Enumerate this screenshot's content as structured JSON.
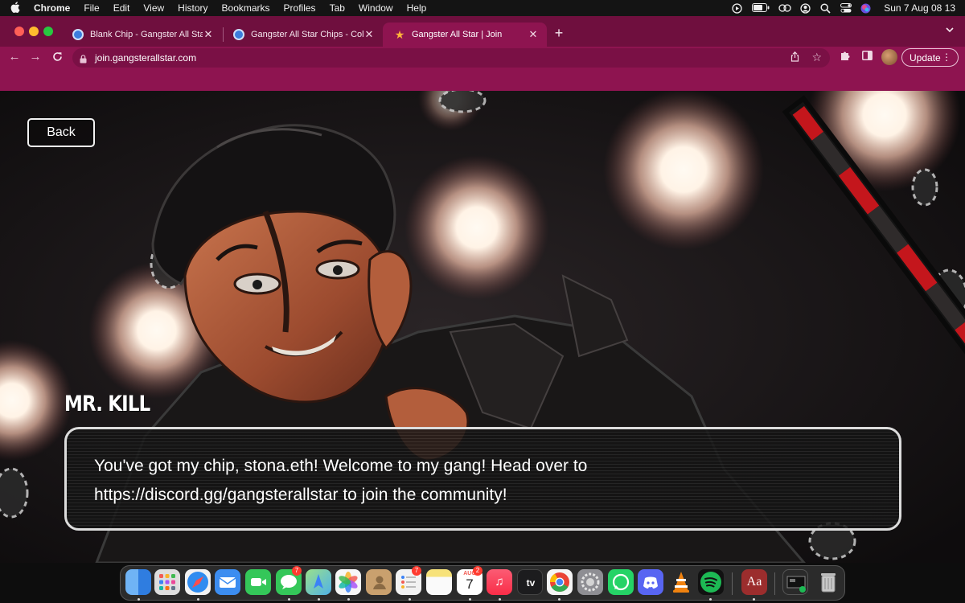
{
  "menubar": {
    "app": "Chrome",
    "items": [
      "File",
      "Edit",
      "View",
      "History",
      "Bookmarks",
      "Profiles",
      "Tab",
      "Window",
      "Help"
    ],
    "clock": "Sun 7 Aug  08 13"
  },
  "browser": {
    "tabs": [
      {
        "title": "Blank Chip - Gangster All Star",
        "favicon": "opensea-icon"
      },
      {
        "title": "Gangster All Star Chips - Colle",
        "favicon": "opensea-icon"
      },
      {
        "title": "Gangster All Star | Join",
        "favicon": "star-icon",
        "active": true
      }
    ],
    "url": "join.gangsterallstar.com",
    "update_label": "Update"
  },
  "page": {
    "back_label": "Back",
    "speaker": "MR. KILL",
    "dialogue_line1": "You've got my chip, stona.eth! Welcome to my gang! Head over to",
    "dialogue_line2": "https://discord.gg/gangsterallstar to join the community!"
  },
  "dock": {
    "apps": [
      {
        "name": "finder",
        "color": "#3d8ee8"
      },
      {
        "name": "launchpad",
        "color": "#e5e5e5"
      },
      {
        "name": "safari",
        "color": "#2f8cf0"
      },
      {
        "name": "mail",
        "color": "#3c8df0"
      },
      {
        "name": "facetime",
        "color": "#34c759"
      },
      {
        "name": "messages",
        "color": "#34c759",
        "badge": "7"
      },
      {
        "name": "maps",
        "color": "#6cc06a"
      },
      {
        "name": "photos",
        "color": "#f0f0f0"
      },
      {
        "name": "contacts",
        "color": "#c9a06e"
      },
      {
        "name": "reminders",
        "color": "#f2f2f2",
        "badge": "7"
      },
      {
        "name": "notes",
        "color": "#f7e27a"
      },
      {
        "name": "calendar",
        "color": "#ffffff",
        "badge": "2",
        "label": "7",
        "month": "AUG"
      },
      {
        "name": "music",
        "color": "#fa3d55"
      },
      {
        "name": "tv",
        "color": "#1c1c1e",
        "label": "tv"
      },
      {
        "name": "chrome",
        "color": "#ffffff"
      },
      {
        "name": "system-settings",
        "color": "#8e8e93"
      },
      {
        "name": "whatsapp",
        "color": "#25d366"
      },
      {
        "name": "discord",
        "color": "#5865f2"
      },
      {
        "name": "vlc",
        "color": "#f0820f"
      },
      {
        "name": "spotify",
        "color": "#1db954"
      },
      {
        "name": "dictionary",
        "color": "#9b2d2d",
        "label": "Aa"
      },
      {
        "name": "screenshot-stack",
        "color": "#2a2a2a"
      },
      {
        "name": "trash",
        "color": "#bdbdbd"
      }
    ]
  }
}
